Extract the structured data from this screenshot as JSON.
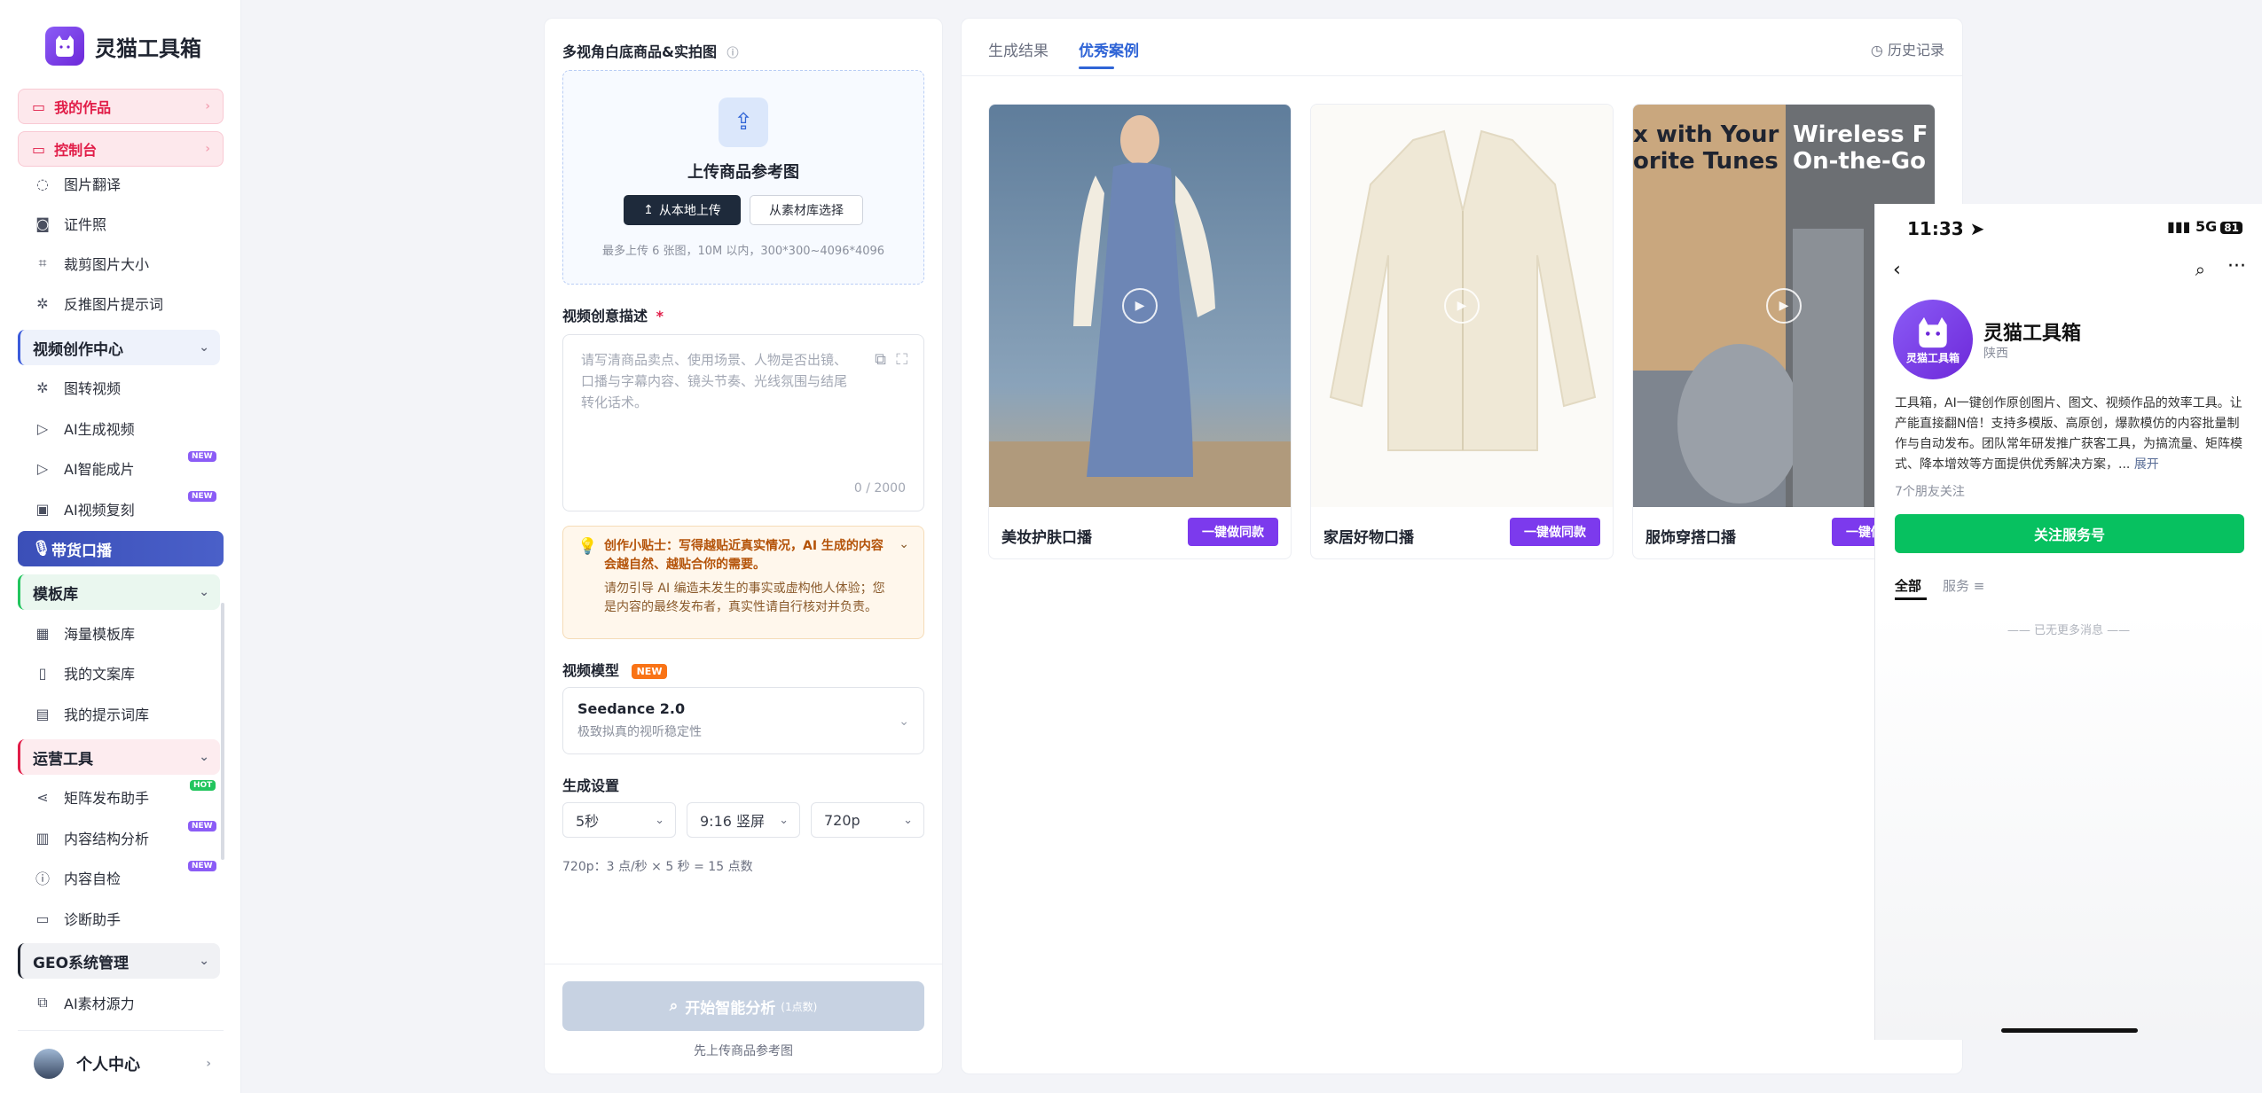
{
  "sidebar": {
    "brand": "灵猫工具箱",
    "pills": [
      {
        "label": "我的作品",
        "icon": "briefcase-icon"
      },
      {
        "label": "控制台",
        "icon": "monitor-icon"
      }
    ],
    "tools_top": [
      {
        "label": "图片翻译",
        "icon": "chat-icon"
      },
      {
        "label": "证件照",
        "icon": "camera-icon"
      },
      {
        "label": "裁剪图片大小",
        "icon": "crop-icon"
      },
      {
        "label": "反推图片提示词",
        "icon": "sparkle-icon"
      }
    ],
    "video_section": "视频创作中心",
    "video_items": [
      {
        "label": "图转视频",
        "icon": "sparkle-icon",
        "badge": ""
      },
      {
        "label": "AI生成视频",
        "icon": "play-circle-icon",
        "badge": ""
      },
      {
        "label": "AI智能成片",
        "icon": "play-circle-icon",
        "badge": "NEW"
      },
      {
        "label": "AI视频复刻",
        "icon": "video-icon",
        "badge": "NEW"
      }
    ],
    "active_item": "带货口播",
    "template_section": "模板库",
    "template_items": [
      {
        "label": "海量模板库",
        "icon": "grid-icon"
      },
      {
        "label": "我的文案库",
        "icon": "book-icon"
      },
      {
        "label": "我的提示词库",
        "icon": "bookmark-icon"
      }
    ],
    "ops_section": "运营工具",
    "ops_items": [
      {
        "label": "矩阵发布助手",
        "icon": "share-icon",
        "badge": "HOT"
      },
      {
        "label": "内容结构分析",
        "icon": "chart-icon",
        "badge": "NEW"
      },
      {
        "label": "内容自检",
        "icon": "alert-icon",
        "badge": "NEW"
      },
      {
        "label": "诊断助手",
        "icon": "monitor-icon",
        "badge": ""
      }
    ],
    "geo_section": "GEO系统管理",
    "geo_items": [
      {
        "label": "AI素材源力",
        "icon": "layers-icon"
      }
    ],
    "user_label": "个人中心"
  },
  "form": {
    "upload_label": "多视角白底商品&实拍图",
    "upload_title": "上传商品参考图",
    "upload_local": "从本地上传",
    "upload_library": "从素材库选择",
    "upload_hint": "最多上传 6 张图，10M 以内，300*300~4096*4096",
    "desc_label": "视频创意描述",
    "required_mark": "*",
    "desc_placeholder": "请写清商品卖点、使用场景、人物是否出镜、口播与字幕内容、镜头节奏、光线氛围与结尾转化话术。",
    "desc_count": "0 / 2000",
    "tip_title": "创作小贴士：写得越贴近真实情况，AI 生成的内容会越自然、越贴合你的需要。",
    "tip_body": "请勿引导 AI 编造未发生的事实或虚构他人体验；您是内容的最终发布者，真实性请自行核对并负责。",
    "model_label": "视频模型",
    "model_tag": "NEW",
    "model_name": "Seedance 2.0",
    "model_desc": "极致拟真的视听稳定性",
    "settings_label": "生成设置",
    "duration": "5秒",
    "ratio": "9:16 竖屏",
    "resolution": "720p",
    "calc_note": "720p：3 点/秒 × 5 秒 = 15 点数",
    "start_label": "开始智能分析",
    "start_cost": "(1点数)",
    "start_hint": "先上传商品参考图"
  },
  "results": {
    "tabs": [
      "生成结果",
      "优秀案例"
    ],
    "active_tab": "优秀案例",
    "history": "历史记录",
    "cards": [
      {
        "title": "美妆护肤口播",
        "button": "一键做同款"
      },
      {
        "title": "家居好物口播",
        "button": "一键做同款"
      },
      {
        "title": "服饰穿搭口播",
        "button": "一键做同款",
        "overlay_left": "x with Your\norite Tunes",
        "overlay_right": "Wireless F\nOn-the-Go"
      }
    ]
  },
  "phone": {
    "time": "11:33",
    "network": "5G",
    "battery": "81",
    "account_name": "灵猫工具箱",
    "avatar_text": "灵猫工具箱",
    "location": "陕西",
    "description": "工具箱，AI一键创作原创图片、图文、视频作品的效率工具。让产能直接翻N倍！支持多模版、高原创，爆款模仿的内容批量制作与自动发布。团队常年研发推广获客工具，为搞流量、矩阵模式、降本增效等方面提供优秀解决方案，...",
    "more": "展开",
    "friends": "7个朋友关注",
    "follow_button": "关注服务号",
    "tabs": [
      "全部",
      "服务"
    ],
    "no_more": "已无更多消息"
  }
}
